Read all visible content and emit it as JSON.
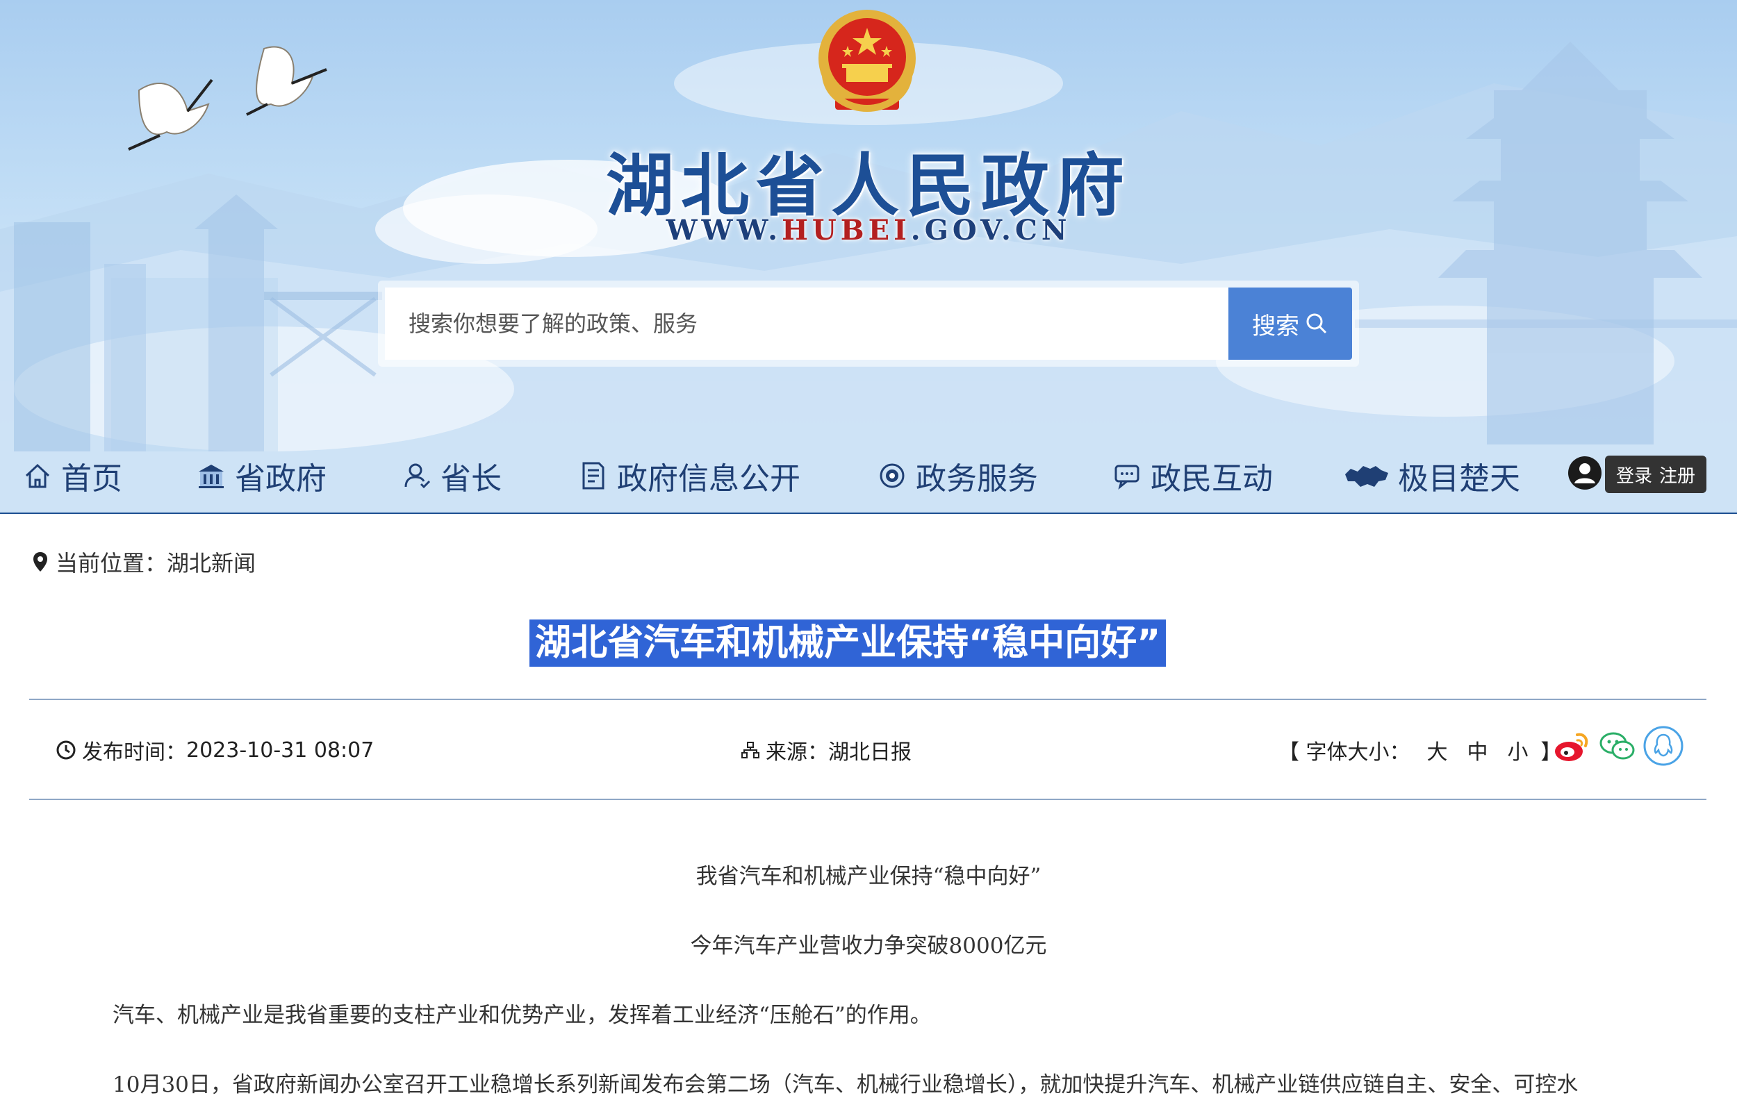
{
  "header": {
    "site_title": "湖北省人民政府",
    "site_url_pre": "WWW.",
    "site_url_mid": "HUBEI",
    "site_url_post": ".GOV.CN"
  },
  "search": {
    "placeholder": "搜索你想要了解的政策、服务",
    "button_label": "搜索"
  },
  "nav": {
    "items": [
      {
        "label": "首页",
        "icon": "home-icon"
      },
      {
        "label": "省政府",
        "icon": "building-icon"
      },
      {
        "label": "省长",
        "icon": "person-icon"
      },
      {
        "label": "政府信息公开",
        "icon": "document-icon"
      },
      {
        "label": "政务服务",
        "icon": "service-icon"
      },
      {
        "label": "政民互动",
        "icon": "chat-icon"
      },
      {
        "label": "极目楚天",
        "icon": "hubei-map-icon"
      }
    ],
    "login_label": "登录",
    "register_label": "注册"
  },
  "breadcrumb": {
    "prefix": "当前位置：",
    "current": "湖北新闻"
  },
  "article": {
    "title": "湖北省汽车和机械产业保持“稳中向好”",
    "publish_label": "发布时间：",
    "publish_time": "2023-10-31 08:07",
    "source_label": "来源：",
    "source": "湖北日报",
    "font_size_label": "【 字体大小：",
    "font_size_options": [
      "大",
      "中",
      "小"
    ],
    "font_size_close": "】",
    "subtitle_1": "我省汽车和机械产业保持“稳中向好”",
    "subtitle_2": "今年汽车产业营收力争突破8000亿元",
    "paragraph_1": "汽车、机械产业是我省重要的支柱产业和优势产业，发挥着工业经济“压舱石”的作用。",
    "paragraph_2": "10月30日，省政府新闻办公室召开工业稳增长系列新闻发布会第二场（汽车、机械行业稳增长），就加快提升汽车、机械产业链供应链自主、安全、可控水"
  },
  "colors": {
    "primary_blue": "#1c4f91",
    "title_highlight": "#3064d6",
    "search_button": "#4b82d6",
    "url_red": "#b32020"
  }
}
